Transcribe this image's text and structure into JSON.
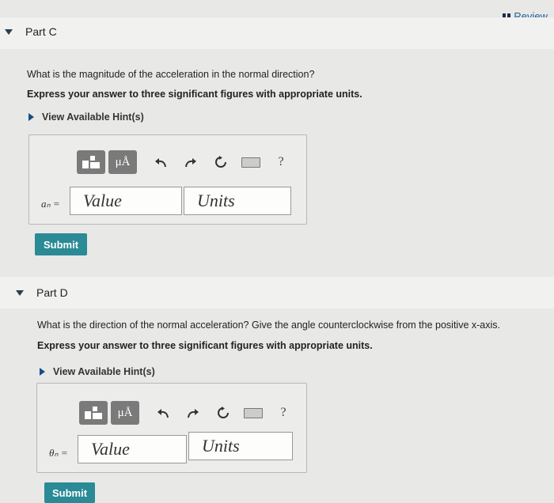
{
  "header": {
    "review_label": "Review"
  },
  "parts": [
    {
      "title": "Part C",
      "question": "What is the magnitude of the acceleration in the normal direction?",
      "instruction": "Express your answer to three significant figures with appropriate units.",
      "hint_label": "View Available Hint(s)",
      "var_label": "aₙ =",
      "value_placeholder": "Value",
      "units_placeholder": "Units",
      "submit_label": "Submit"
    },
    {
      "title": "Part D",
      "question": "What is the direction of the normal acceleration? Give the angle counterclockwise from the positive x-axis.",
      "instruction": "Express your answer to three significant figures with appropriate units.",
      "hint_label": "View Available Hint(s)",
      "var_label": "θₙ =",
      "value_placeholder": "Value",
      "units_placeholder": "Units",
      "submit_label": "Submit"
    }
  ],
  "toolbar": {
    "mu_label": "μÅ",
    "help_label": "?",
    "icons": [
      "templates-icon",
      "symbols-icon",
      "undo-icon",
      "redo-icon",
      "reset-icon",
      "keyboard-icon",
      "help-icon"
    ]
  },
  "colors": {
    "accent": "#2a8a96",
    "link": "#1f5f9a",
    "toolbar_button": "#7a7a7a"
  }
}
